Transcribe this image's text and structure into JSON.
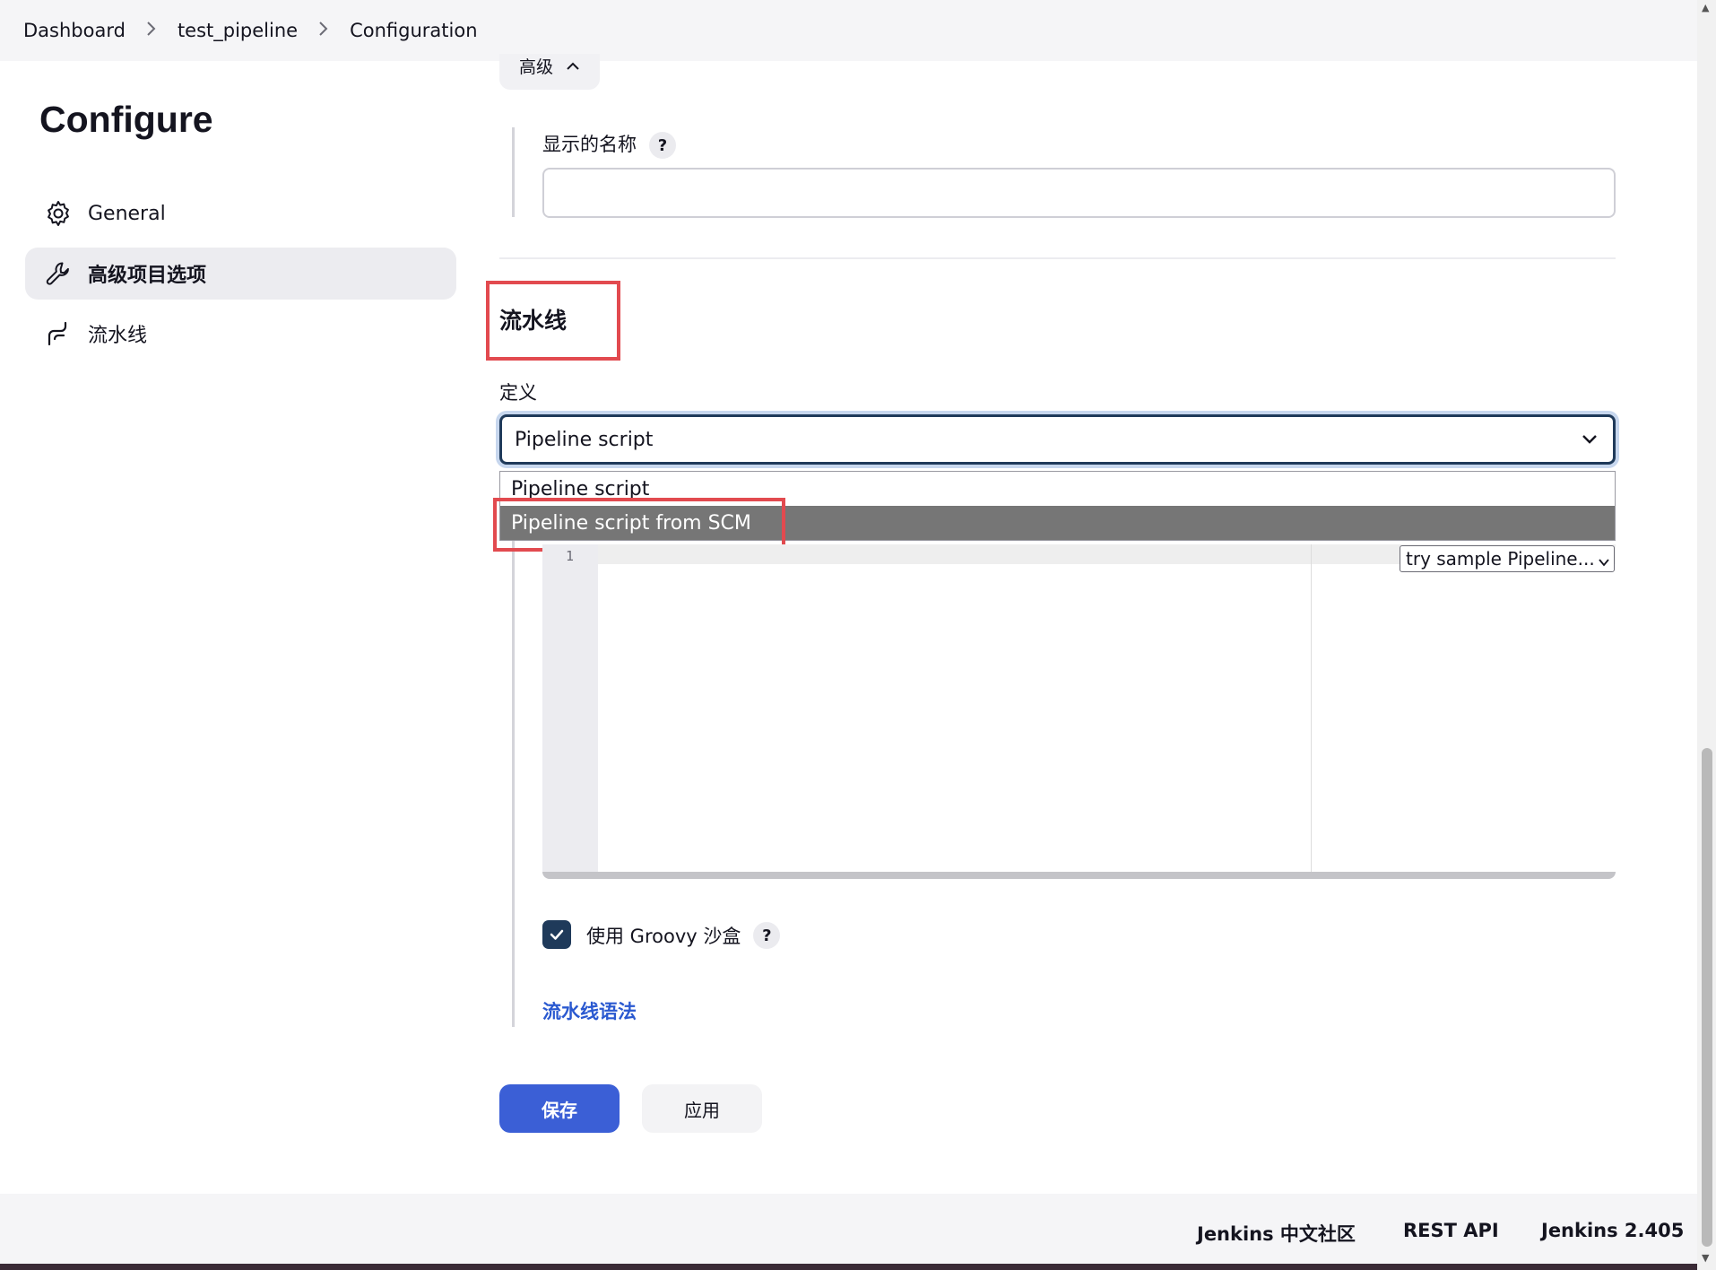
{
  "breadcrumb": {
    "items": [
      "Dashboard",
      "test_pipeline",
      "Configuration"
    ],
    "separator": ">"
  },
  "sidebar": {
    "title": "Configure",
    "items": [
      {
        "label": "General",
        "icon": "gear-icon",
        "active": false
      },
      {
        "label": "高级项目选项",
        "icon": "wrench-icon",
        "active": true
      },
      {
        "label": "流水线",
        "icon": "pipeline-icon",
        "active": false
      }
    ]
  },
  "advanced": {
    "toggle_label": "高级",
    "display_name_label": "显示的名称",
    "display_name_value": "",
    "help": "?"
  },
  "pipeline": {
    "section_title": "流水线",
    "definition_label": "定义",
    "definition_selected": "Pipeline script",
    "definition_options": [
      "Pipeline script",
      "Pipeline script from SCM"
    ],
    "highlighted_option": "Pipeline script from SCM",
    "editor_line_number": "1",
    "sample_select": "try sample Pipeline...",
    "groovy_sandbox_label": "使用 Groovy 沙盒",
    "groovy_sandbox_checked": true,
    "help": "?",
    "syntax_link": "流水线语法"
  },
  "buttons": {
    "save": "保存",
    "apply": "应用"
  },
  "footer": {
    "community": "Jenkins 中文社区",
    "rest_api": "REST API",
    "version": "Jenkins 2.405"
  },
  "colors": {
    "accent": "#3b5fd6",
    "highlight_box": "#e24a4f",
    "link": "#2a59d0",
    "checkbox": "#1f3a5a"
  }
}
